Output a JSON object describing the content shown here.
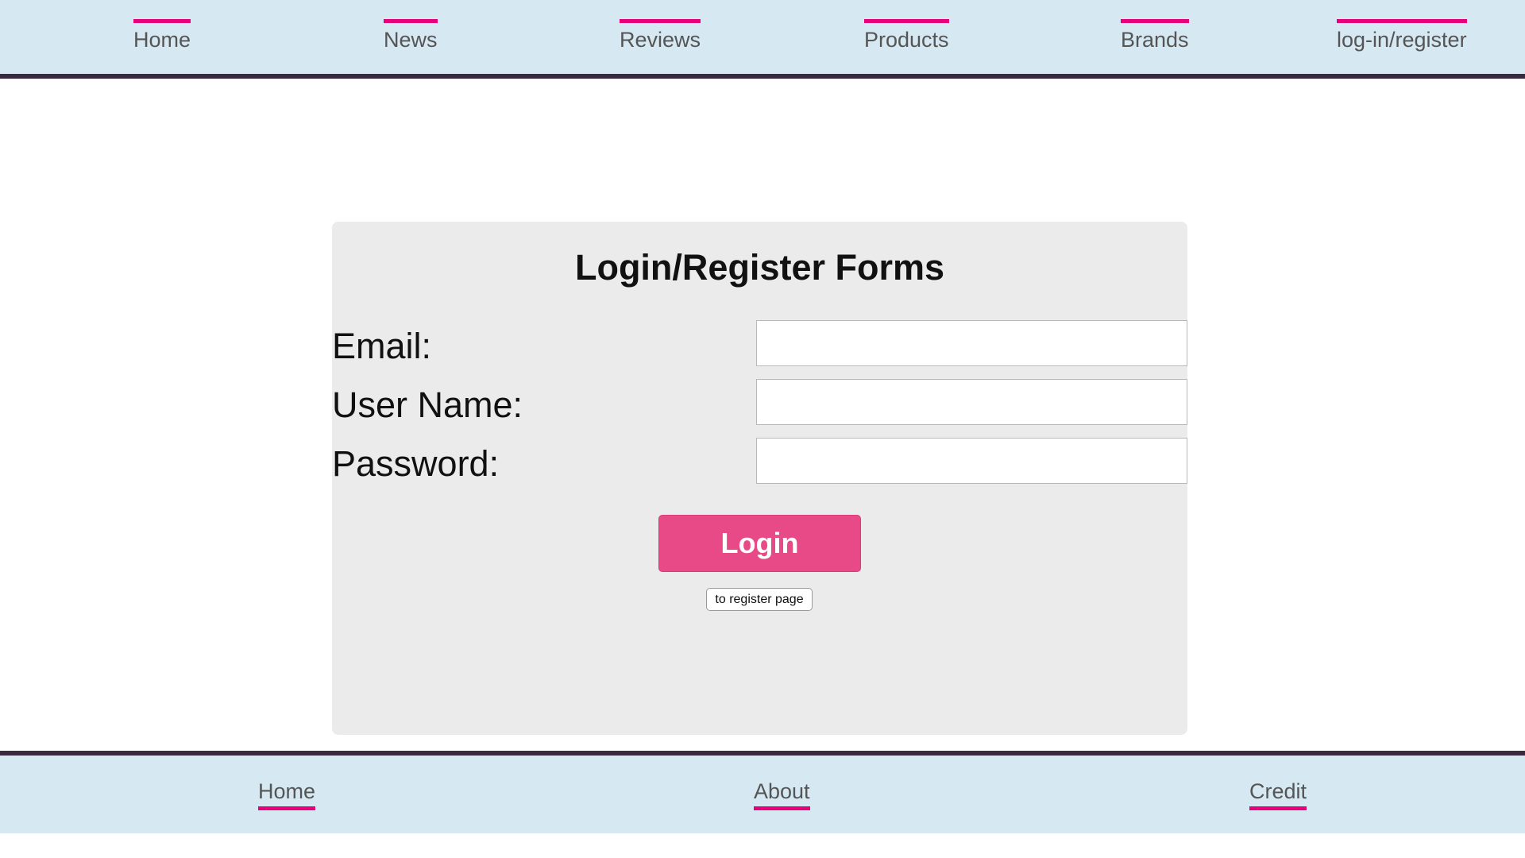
{
  "nav": {
    "items": [
      {
        "label": "Home"
      },
      {
        "label": "News"
      },
      {
        "label": "Reviews"
      },
      {
        "label": "Products"
      },
      {
        "label": "Brands"
      },
      {
        "label": "log-in/register"
      }
    ]
  },
  "form": {
    "title": "Login/Register Forms",
    "email_label": "Email:",
    "email_value": "",
    "username_label": "User Name:",
    "username_value": "",
    "password_label": "Password:",
    "password_value": "",
    "login_button": "Login",
    "register_button": "to register page"
  },
  "footer": {
    "items": [
      {
        "label": "Home"
      },
      {
        "label": "About"
      },
      {
        "label": "Credit"
      }
    ]
  },
  "colors": {
    "nav_background": "#d6e8f2",
    "accent_pink": "#e6007a",
    "login_button": "#e84a87",
    "divider": "#3a2a40",
    "panel_background": "#ebebeb"
  }
}
